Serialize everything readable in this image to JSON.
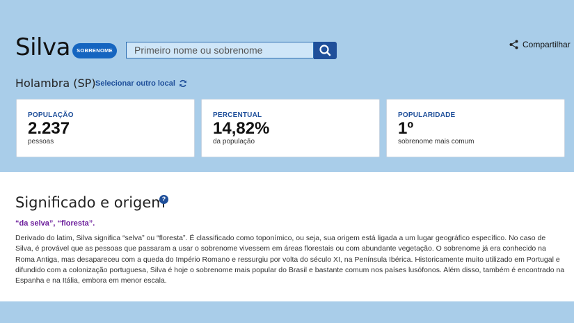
{
  "header": {
    "surname": "Silva",
    "badge": "SOBRENOME",
    "search_placeholder": "Primeiro nome ou sobrenome",
    "share_label": "Compartilhar"
  },
  "location": {
    "place": "Holambra (SP)",
    "change_label": "Selecionar outro local"
  },
  "stats": [
    {
      "label": "POPULAÇÃO",
      "value": "2.237",
      "sub": "pessoas"
    },
    {
      "label": "PERCENTUAL",
      "value": "14,82%",
      "sub": "da população"
    },
    {
      "label": "POPULARIDADE",
      "value": "1º",
      "sub": "sobrenome mais comum"
    }
  ],
  "meaning": {
    "heading": "Significado e origem",
    "help": "?",
    "short": "“da selva”, “floresta”.",
    "text": "Derivado do latim, Silva significa “selva” ou “floresta”. É classificado como toponímico, ou seja, sua origem está ligada a um lugar geográfico específico. No caso de Silva, é provável que as pessoas que passaram a usar o sobrenome vivessem em áreas florestais ou com abundante vegetação. O sobrenome já era conhecido na Roma Antiga, mas desapareceu com a queda do Império Romano e ressurgiu por volta do século XI, na Península Ibérica. Historicamente muito utilizado em Portugal e difundido com a colonização portuguesa, Silva é hoje o sobrenome mais popular do Brasil e bastante comum nos países lusófonos. Além disso, também é encontrado na Espanha e na Itália, embora em menor escala."
  },
  "colors": {
    "accent": "#1f4f9a",
    "badge": "#1565c0",
    "band": "#a9cde9",
    "meaning": "#6a1b9a"
  }
}
